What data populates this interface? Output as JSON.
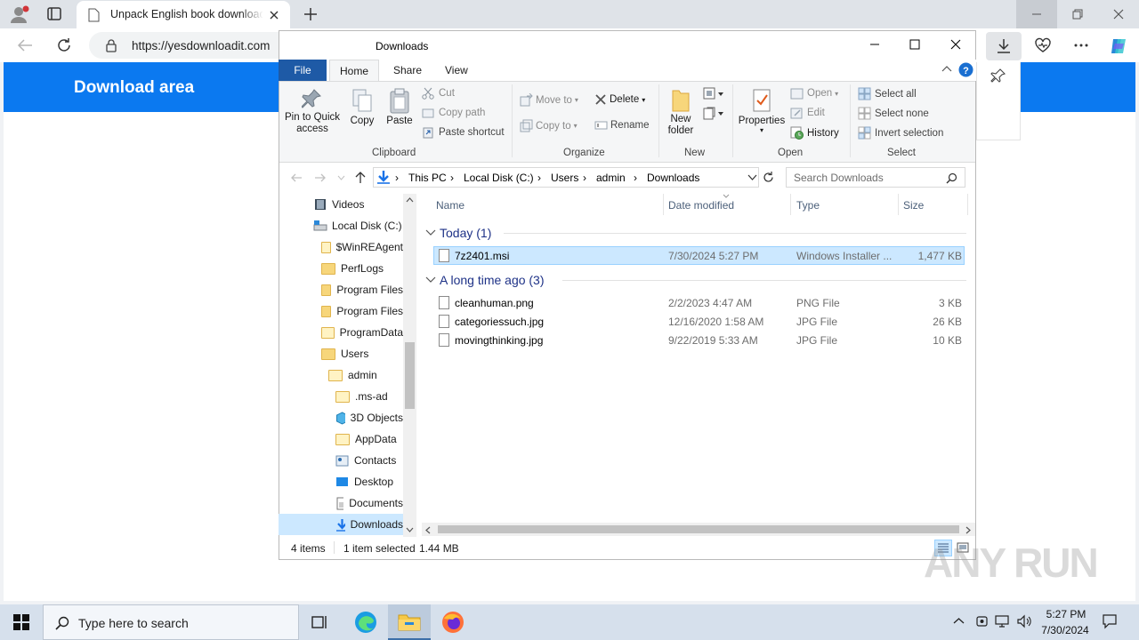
{
  "browser": {
    "tab_title": "Unpack English book download",
    "url": "https://yesdownloadit.com",
    "downloads_folder_label": "Downloads"
  },
  "page": {
    "header_title": "Download area"
  },
  "explorer": {
    "title": "Downloads",
    "ribbon_tabs": {
      "file": "File",
      "home": "Home",
      "share": "Share",
      "view": "View"
    },
    "clipboard": {
      "pin": "Pin to Quick access",
      "copy": "Copy",
      "paste": "Paste",
      "cut": "Cut",
      "copy_path": "Copy path",
      "paste_shortcut": "Paste shortcut",
      "group": "Clipboard"
    },
    "organize": {
      "move_to": "Move to",
      "copy_to": "Copy to",
      "delete": "Delete",
      "rename": "Rename",
      "group": "Organize"
    },
    "new": {
      "new_folder": "New folder",
      "group": "New"
    },
    "open": {
      "properties": "Properties",
      "open": "Open",
      "edit": "Edit",
      "history": "History",
      "group": "Open"
    },
    "select": {
      "select_all": "Select all",
      "select_none": "Select none",
      "invert": "Invert selection",
      "group": "Select"
    },
    "breadcrumb": [
      "This PC",
      "Local Disk (C:)",
      "Users",
      "admin",
      "Downloads"
    ],
    "search_placeholder": "Search Downloads",
    "tree": [
      {
        "label": "Videos"
      },
      {
        "label": "Local Disk (C:)"
      },
      {
        "label": "$WinREAgent"
      },
      {
        "label": "PerfLogs"
      },
      {
        "label": "Program Files"
      },
      {
        "label": "Program Files"
      },
      {
        "label": "ProgramData"
      },
      {
        "label": "Users"
      },
      {
        "label": "admin"
      },
      {
        "label": ".ms-ad"
      },
      {
        "label": "3D Objects"
      },
      {
        "label": "AppData"
      },
      {
        "label": "Contacts"
      },
      {
        "label": "Desktop"
      },
      {
        "label": "Documents"
      },
      {
        "label": "Downloads"
      }
    ],
    "columns": {
      "name": "Name",
      "date": "Date modified",
      "type": "Type",
      "size": "Size"
    },
    "groups": [
      {
        "title": "Today (1)",
        "files": [
          {
            "name": "7z2401.msi",
            "date": "7/30/2024 5:27 PM",
            "type": "Windows Installer ...",
            "size": "1,477 KB"
          }
        ]
      },
      {
        "title": "A long time ago (3)",
        "files": [
          {
            "name": "cleanhuman.png",
            "date": "2/2/2023 4:47 AM",
            "type": "PNG File",
            "size": "3 KB"
          },
          {
            "name": "categoriessuch.jpg",
            "date": "12/16/2020 1:58 AM",
            "type": "JPG File",
            "size": "26 KB"
          },
          {
            "name": "movingthinking.jpg",
            "date": "9/22/2019 5:33 AM",
            "type": "JPG File",
            "size": "10 KB"
          }
        ]
      }
    ],
    "status": {
      "items": "4 items",
      "selected": "1 item selected",
      "size": "1.44 MB"
    }
  },
  "taskbar": {
    "search_placeholder": "Type here to search",
    "time": "5:27 PM",
    "date": "7/30/2024"
  },
  "watermark": "ANY RUN",
  "colors": {
    "accent": "#0b79f0",
    "explorer_file_tab": "#1e5aa6",
    "selection": "#cce8ff"
  }
}
